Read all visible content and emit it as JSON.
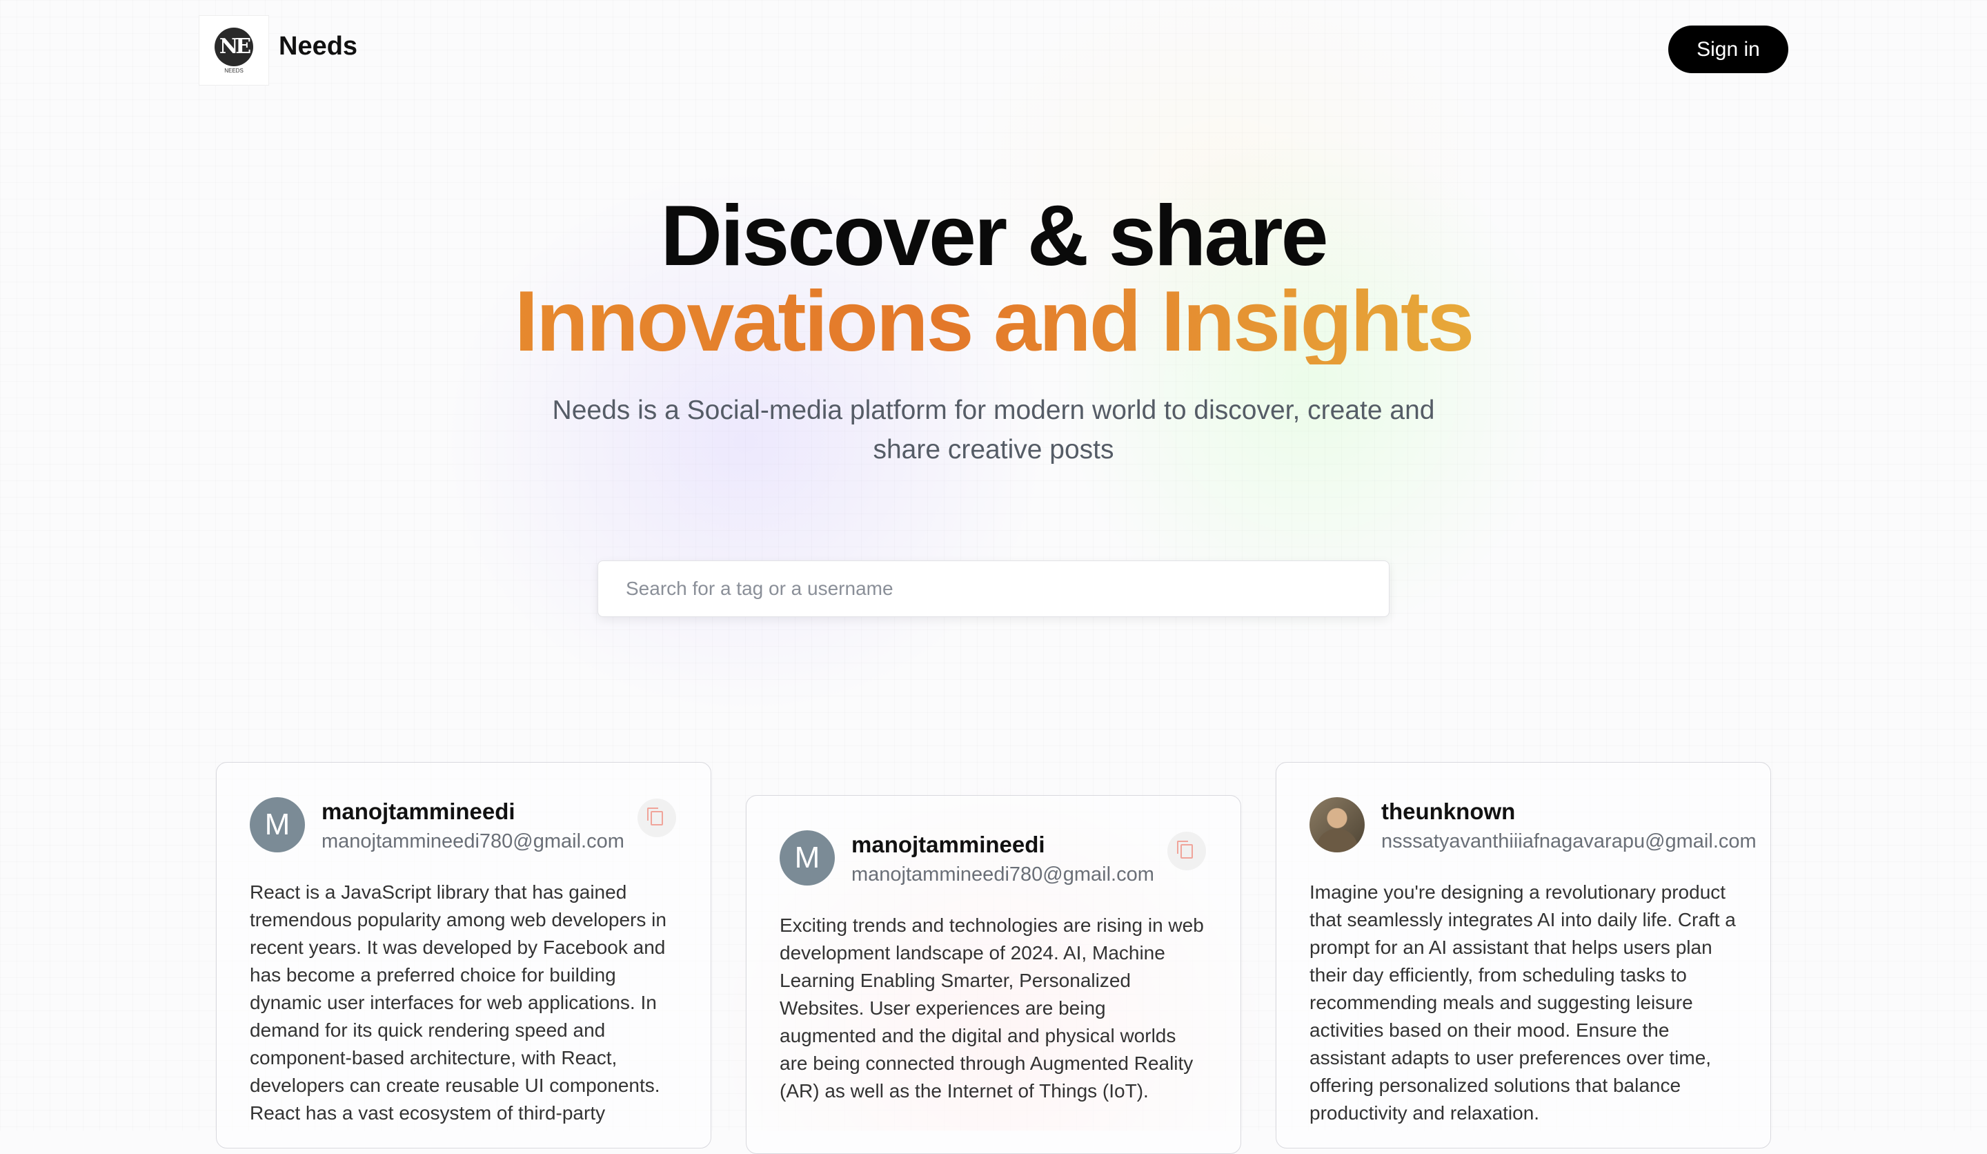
{
  "brand": {
    "name": "Needs",
    "logo_text": "NE",
    "logo_caption": "NEEDS"
  },
  "nav": {
    "signin_label": "Sign in"
  },
  "hero": {
    "title_line1": "Discover & share",
    "title_line2": "Innovations and Insights",
    "description": "Needs is a Social-media platform for modern world to discover, create and share creative posts"
  },
  "search": {
    "placeholder": "Search for a tag or a username",
    "value": ""
  },
  "posts": [
    {
      "avatar_letter": "M",
      "username": "manojtammineedi",
      "email": "manojtammineedi780@gmail.com",
      "text": "React is a JavaScript library that has gained tremendous popularity among web developers in recent years. It was developed by Facebook and has become a preferred choice for building dynamic user interfaces for web applications. In demand for its quick rendering speed and component-based architecture, with React, developers can create reusable UI components. React has a vast ecosystem of third-party"
    },
    {
      "avatar_letter": "M",
      "username": "manojtammineedi",
      "email": "manojtammineedi780@gmail.com",
      "text": "Exciting trends and technologies are rising in web development landscape of 2024. AI, Machine Learning Enabling Smarter, Personalized Websites. User experiences are being augmented and the digital and physical worlds are being connected through Augmented Reality (AR) as well as the Internet of Things (IoT)."
    },
    {
      "avatar_letter": "",
      "username": "theunknown",
      "email": "nsssatyavanthiiiafnagavarapu@gmail.com",
      "text": "Imagine you're designing a revolutionary product that seamlessly integrates AI into daily life. Craft a prompt for an AI assistant that helps users plan their day efficiently, from scheduling tasks to recommending meals and suggesting leisure activities based on their mood. Ensure the assistant adapts to user preferences over time, offering personalized solutions that balance productivity and relaxation."
    }
  ],
  "icons": {
    "copy": "copy-icon"
  },
  "colors": {
    "accent_start": "#e6892e",
    "accent_end": "#e7a93a",
    "button_bg": "#000000"
  }
}
